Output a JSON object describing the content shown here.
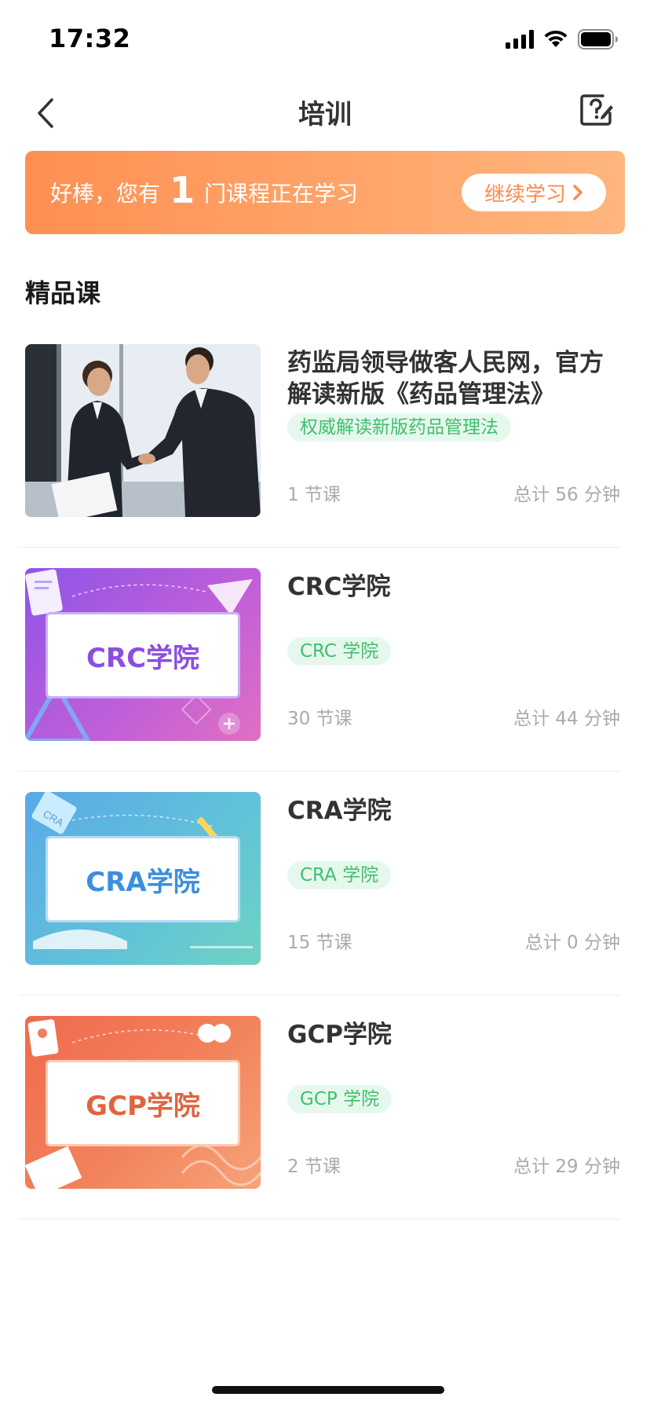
{
  "status": {
    "time": "17:32"
  },
  "nav": {
    "title": "培训",
    "back_icon": "chevron-left-icon",
    "help_icon": "help-edit-icon"
  },
  "banner": {
    "prefix": "好棒，您有",
    "count": "1",
    "suffix": "门课程正在学习",
    "button_label": "继续学习",
    "gradient_start": "#ff8f52",
    "gradient_end": "#ffb67d"
  },
  "section": {
    "title": "精品课"
  },
  "courses": [
    {
      "title": "药监局领导做客人民网，官方解读新版《药品管理法》",
      "tag": "权威解读新版药品管理法",
      "lessons": "1 节课",
      "duration": "总计 56 分钟",
      "thumb_type": "photo"
    },
    {
      "title": "CRC学院",
      "tag": "CRC 学院",
      "lessons": "30 节课",
      "duration": "总计 44 分钟",
      "thumb_label": "CRC学院",
      "thumb_color": "#8c4ee0"
    },
    {
      "title": "CRA学院",
      "tag": "CRA 学院",
      "lessons": "15 节课",
      "duration": "总计 0 分钟",
      "thumb_label": "CRA学院",
      "thumb_color": "#3b8fdc",
      "thumb_badge": "CRA"
    },
    {
      "title": "GCP学院",
      "tag": "GCP 学院",
      "lessons": "2 节课",
      "duration": "总计 29 分钟",
      "thumb_label": "GCP学院",
      "thumb_color": "#e0653f"
    }
  ]
}
